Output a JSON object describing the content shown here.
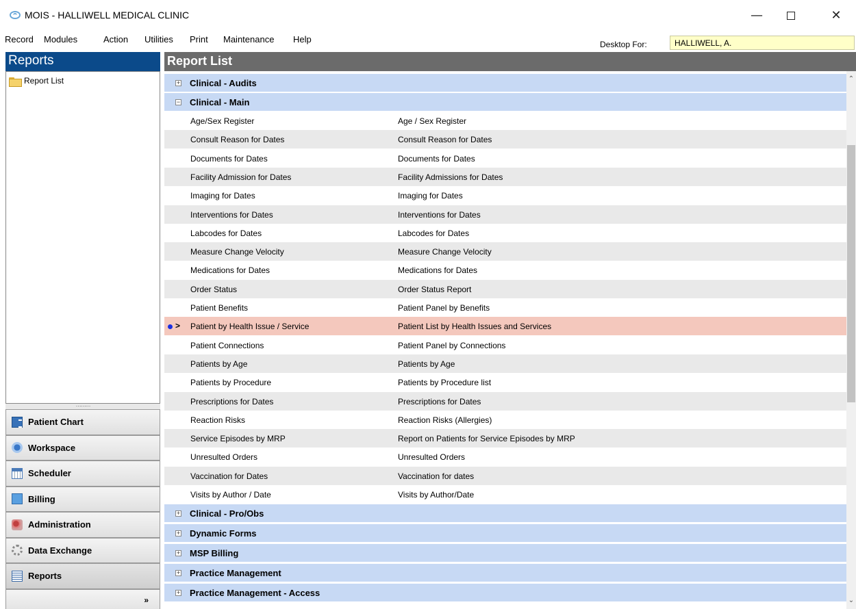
{
  "window": {
    "title": "MOIS - HALLIWELL MEDICAL CLINIC",
    "minimize": "—",
    "close": "✕"
  },
  "menu": [
    "Record",
    "Modules",
    "Action",
    "Utilities",
    "Print",
    "Maintenance",
    "Help"
  ],
  "desktop": {
    "label": "Desktop For:",
    "value": "HALLIWELL, A."
  },
  "left": {
    "header": "Reports",
    "tree_item": "Report List",
    "splitter": "………",
    "nav": [
      {
        "label": "Patient Chart",
        "icon": "patient-chart-icon"
      },
      {
        "label": "Workspace",
        "icon": "workspace-icon"
      },
      {
        "label": "Scheduler",
        "icon": "scheduler-icon"
      },
      {
        "label": "Billing",
        "icon": "billing-icon"
      },
      {
        "label": "Administration",
        "icon": "administration-icon"
      },
      {
        "label": "Data Exchange",
        "icon": "data-exchange-icon"
      },
      {
        "label": "Reports",
        "icon": "reports-icon"
      }
    ],
    "expand_chevron": "»"
  },
  "right": {
    "header": "Report List",
    "groups_top": [
      {
        "label": "Clinical - Audits",
        "expanded": false
      },
      {
        "label": "Clinical - Main",
        "expanded": true
      }
    ],
    "items": [
      {
        "name": "Age/Sex Register",
        "desc": "Age / Sex Register"
      },
      {
        "name": "Consult Reason for Dates",
        "desc": "Consult Reason for Dates"
      },
      {
        "name": "Documents for Dates",
        "desc": "Documents for Dates"
      },
      {
        "name": "Facility Admission for Dates",
        "desc": "Facility Admissions for Dates"
      },
      {
        "name": "Imaging for Dates",
        "desc": "Imaging for Dates"
      },
      {
        "name": "Interventions for Dates",
        "desc": "Interventions for Dates"
      },
      {
        "name": "Labcodes for Dates",
        "desc": "Labcodes for Dates"
      },
      {
        "name": "Measure Change Velocity",
        "desc": "Measure Change Velocity"
      },
      {
        "name": "Medications for Dates",
        "desc": "Medications for Dates"
      },
      {
        "name": "Order Status",
        "desc": "Order Status Report"
      },
      {
        "name": "Patient Benefits",
        "desc": "Patient Panel by Benefits"
      },
      {
        "name": "Patient by Health Issue / Service",
        "desc": "Patient List by Health Issues and Services",
        "selected": true
      },
      {
        "name": "Patient Connections",
        "desc": "Patient Panel by Connections"
      },
      {
        "name": "Patients by Age",
        "desc": "Patients by Age"
      },
      {
        "name": "Patients by Procedure",
        "desc": "Patients by Procedure list"
      },
      {
        "name": "Prescriptions for Dates",
        "desc": "Prescriptions for Dates"
      },
      {
        "name": "Reaction Risks",
        "desc": "Reaction Risks (Allergies)"
      },
      {
        "name": "Service Episodes by MRP",
        "desc": "Report on Patients for Service Episodes by MRP"
      },
      {
        "name": "Unresulted Orders",
        "desc": "Unresulted Orders"
      },
      {
        "name": "Vaccination for Dates",
        "desc": "Vaccination for dates"
      },
      {
        "name": "Visits by Author / Date",
        "desc": "Visits by Author/Date"
      }
    ],
    "groups_bottom": [
      {
        "label": "Clinical - Pro/Obs",
        "expanded": false
      },
      {
        "label": "Dynamic Forms",
        "expanded": false
      },
      {
        "label": "MSP Billing",
        "expanded": false
      },
      {
        "label": "Practice Management",
        "expanded": false
      },
      {
        "label": "Practice Management - Access",
        "expanded": false
      }
    ],
    "selected_marker": ">"
  },
  "colors": {
    "left_header_bg": "#0b4a8a",
    "group_row_bg": "#c7d9f4",
    "selected_row_bg": "#f4c8bd",
    "alt_row_bg": "#e9e9e9"
  }
}
